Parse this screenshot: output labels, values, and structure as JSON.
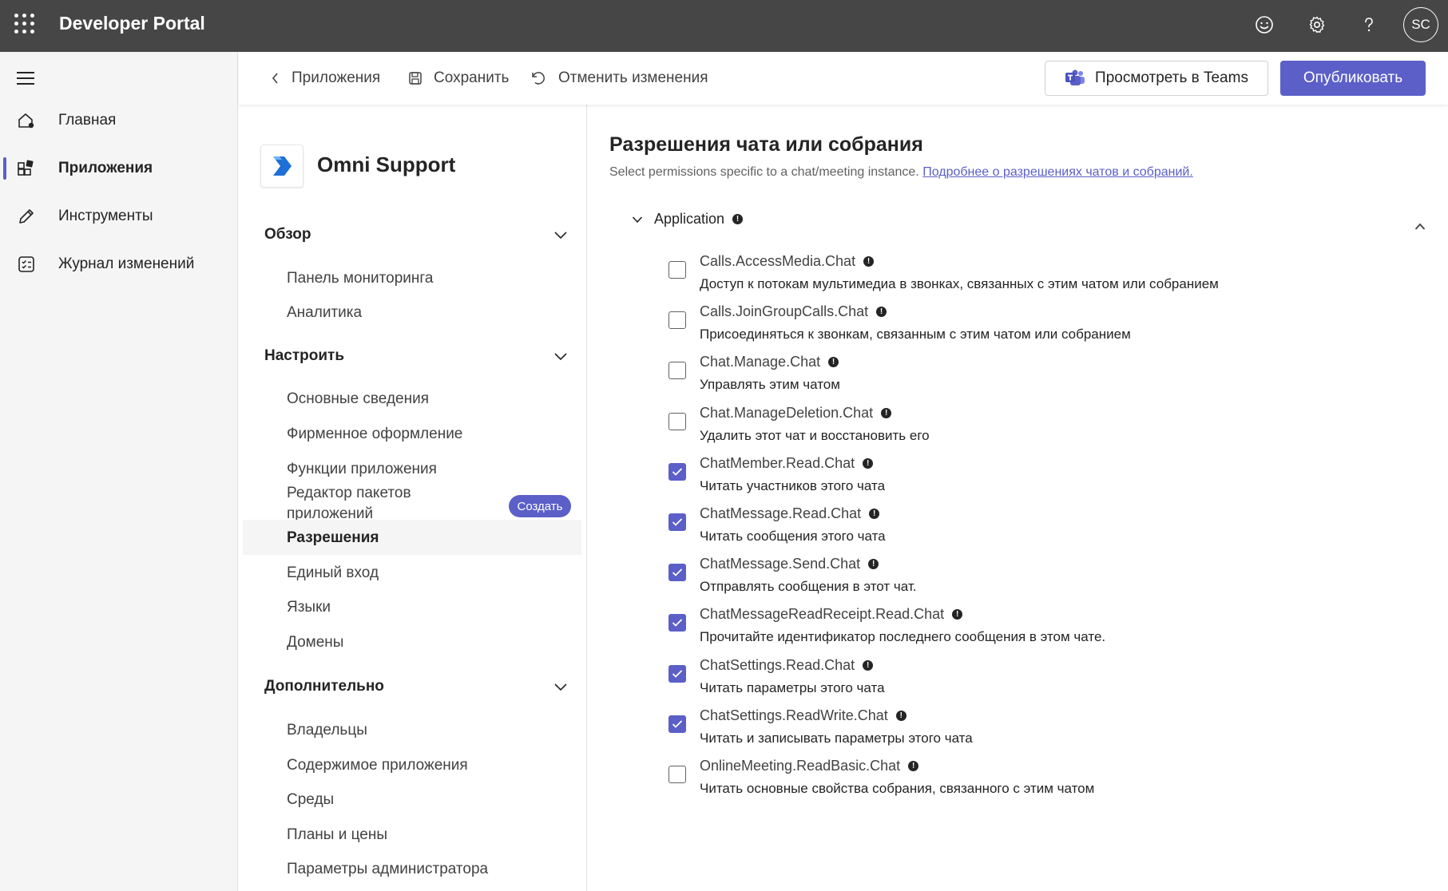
{
  "header": {
    "app_title": "Developer Portal",
    "avatar_initials": "SC",
    "icons": [
      "waffle-icon",
      "smiley-icon",
      "gear-icon",
      "help-icon"
    ]
  },
  "leftnav": {
    "items": [
      {
        "label": "Главная",
        "icon": "home-icon"
      },
      {
        "label": "Приложения",
        "icon": "apps-icon",
        "active": true
      },
      {
        "label": "Инструменты",
        "icon": "pencil-icon"
      },
      {
        "label": "Журнал изменений",
        "icon": "changelog-icon"
      }
    ]
  },
  "commandbar": {
    "back_label": "Приложения",
    "save_label": "Сохранить",
    "undo_label": "Отменить изменения",
    "teams_label": "Просмотреть в Teams",
    "publish_label": "Опубликовать"
  },
  "subnav": {
    "app_name": "Omni Support",
    "sections": [
      {
        "title": "Обзор",
        "items": [
          "Панель мониторинга",
          "Аналитика"
        ]
      },
      {
        "title": "Настроить",
        "items": [
          "Основные сведения",
          "Фирменное оформление",
          "Функции приложения",
          "Редактор пакетов приложений",
          "Разрешения",
          "Единый вход",
          "Языки",
          "Домены"
        ]
      },
      {
        "title": "Дополнительно",
        "items": [
          "Владельцы",
          "Содержимое приложения",
          "Среды",
          "Планы и цены",
          "Параметры администратора"
        ]
      }
    ],
    "create_badge": "Создать",
    "active_item": "Разрешения"
  },
  "main": {
    "title": "Разрешения чата или собрания",
    "subtitle": "Select permissions specific to a chat/meeting instance.",
    "subtitle_link": "Подробнее о разрешениях чатов и собраний.",
    "group_label": "Application",
    "permissions": [
      {
        "name": "Calls.AccessMedia.Chat",
        "desc": "Доступ к потокам мультимедиа в звонках, связанных с этим чатом или собранием",
        "checked": false
      },
      {
        "name": "Calls.JoinGroupCalls.Chat",
        "desc": "Присоединяться к звонкам, связанным с этим чатом или собранием",
        "checked": false
      },
      {
        "name": "Chat.Manage.Chat",
        "desc": "Управлять этим чатом",
        "checked": false
      },
      {
        "name": "Chat.ManageDeletion.Chat",
        "desc": "Удалить этот чат и восстановить его",
        "checked": false
      },
      {
        "name": "ChatMember.Read.Chat",
        "desc": "Читать участников этого чата",
        "checked": true
      },
      {
        "name": "ChatMessage.Read.Chat",
        "desc": "Читать сообщения этого чата",
        "checked": true
      },
      {
        "name": "ChatMessage.Send.Chat",
        "desc": "Отправлять сообщения в этот чат.",
        "checked": true
      },
      {
        "name": "ChatMessageReadReceipt.Read.Chat",
        "desc": "Прочитайте идентификатор последнего сообщения в этом чате.",
        "checked": true
      },
      {
        "name": "ChatSettings.Read.Chat",
        "desc": "Читать параметры этого чата",
        "checked": true
      },
      {
        "name": "ChatSettings.ReadWrite.Chat",
        "desc": "Читать и записывать параметры этого чата",
        "checked": true
      },
      {
        "name": "OnlineMeeting.ReadBasic.Chat",
        "desc": "Читать основные свойства собрания, связанного с этим чатом",
        "checked": false
      }
    ],
    "colors": {
      "accent": "#5b5fc7",
      "topbar": "#464646"
    }
  }
}
